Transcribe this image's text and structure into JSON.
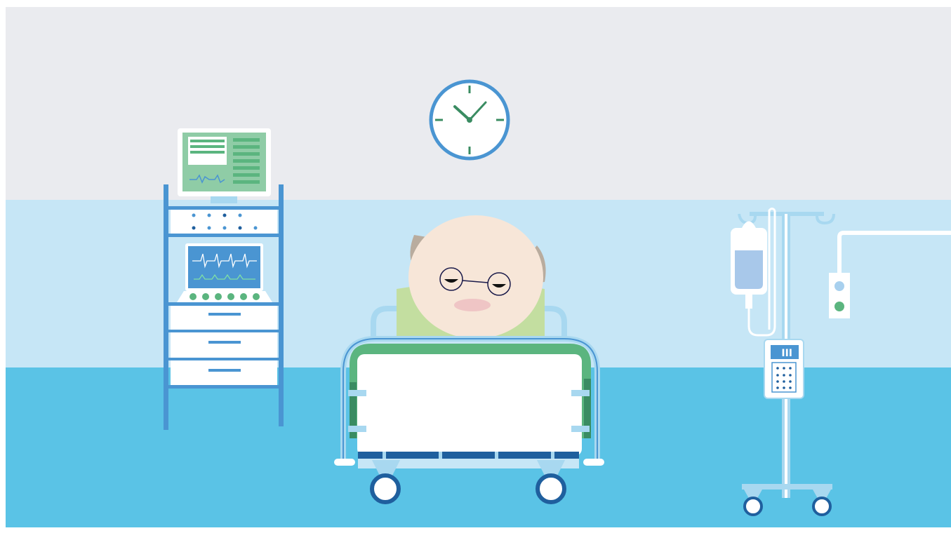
{
  "scene": {
    "description_free": true,
    "palette": {
      "wall_upper": "#eaebef",
      "wall_lower": "#c6e6f6",
      "floor": "#5ac3e6",
      "accent_blue": "#4a95d2",
      "accent_dark_blue": "#1f5f9e",
      "accent_green": "#5bb57f",
      "dark_green": "#3a8c62",
      "skin": "#f7e6d8",
      "hair": "#b9ac9e",
      "pillow": "#c3dea0",
      "white": "#ffffff"
    },
    "icons": [
      "wall-clock-icon",
      "patient-monitor-icon",
      "equipment-cart-icon",
      "hospital-bed-icon",
      "patient-figure-icon",
      "iv-drip-stand-icon",
      "infusion-pump-icon",
      "wall-outlet-icon"
    ],
    "infusion_pump_label": "III"
  }
}
